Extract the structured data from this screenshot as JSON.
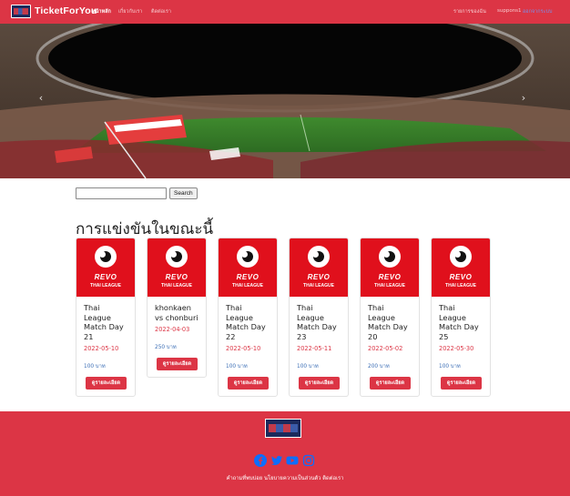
{
  "nav": {
    "brand": "TicketForYou",
    "links": [
      "หน้าหลัก",
      "เกี่ยวกับเรา",
      "ติดต่อเรา"
    ],
    "right_label": "รายการของฉัน",
    "user_label": "suppons1",
    "user_action": "ออกจากระบบ"
  },
  "search": {
    "placeholder": "",
    "button_label": "Search"
  },
  "section_title": "การแข่งขันในขณะนี้",
  "cards": [
    {
      "title": "Thai League Match Day 21",
      "date": "2022-05-10",
      "price": "100 บาท",
      "button": "ดูรายละเอียด"
    },
    {
      "title": "khonkaen vs chonburi",
      "date": "2022-04-03",
      "price": "250 บาท",
      "button": "ดูรายละเอียด"
    },
    {
      "title": "Thai League Match Day 22",
      "date": "2022-05-10",
      "price": "100 บาท",
      "button": "ดูรายละเอียด"
    },
    {
      "title": "Thai League Match Day 23",
      "date": "2022-05-11",
      "price": "100 บาท",
      "button": "ดูรายละเอียด"
    },
    {
      "title": "Thai League Match Day 20",
      "date": "2022-05-02",
      "price": "200 บาท",
      "button": "ดูรายละเอียด"
    },
    {
      "title": "Thai League Match Day 25",
      "date": "2022-05-30",
      "price": "100 บาท",
      "button": "ดูรายละเอียด"
    }
  ],
  "card_logo": {
    "brand": "REVO",
    "league": "THAI LEAGUE"
  },
  "footer": {
    "links": "คำถามที่พบบ่อย นโยบายความเป็นส่วนตัว ติดต่อเรา",
    "social_icons": [
      "facebook-icon",
      "twitter-icon",
      "youtube-icon",
      "instagram-icon"
    ]
  },
  "colors": {
    "primary": "#dc3545",
    "link": "#0d6efd",
    "price": "#3a6db5"
  }
}
